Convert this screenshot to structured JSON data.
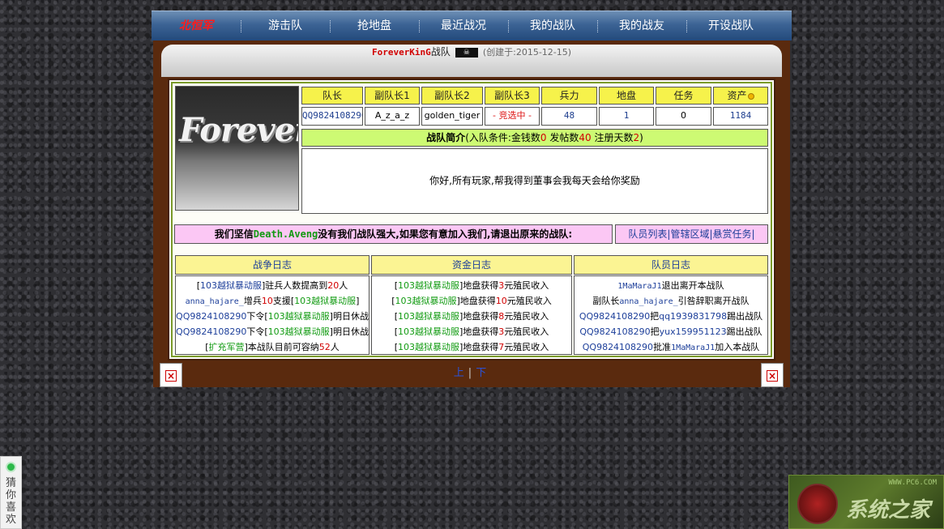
{
  "nav": {
    "items": [
      "北恒军",
      "游击队",
      "抢地盘",
      "最近战况",
      "我的战队",
      "我的战友",
      "开设战队"
    ]
  },
  "header": {
    "team_name": "ForeverKinG",
    "team_suffix": "战队",
    "flag_icon": "pirate-flag-icon",
    "created": "(创建于:2015-12-15)"
  },
  "logo": {
    "text": "Forever"
  },
  "stats": {
    "headers": [
      "队长",
      "副队长1",
      "副队长2",
      "副队长3",
      "兵力",
      "地盘",
      "任务",
      "资产"
    ],
    "values": [
      "QQ9824108290",
      "A_z_a_z",
      "golden_tiger",
      "- 竞选中 -",
      "48",
      "1",
      "0",
      "1184"
    ],
    "asset_icon": "coin-icon"
  },
  "intro": {
    "title": "战队简介",
    "cond_open": "(入队条件:金钱数",
    "money": "0",
    "posts_label": " 发帖数",
    "posts": "40",
    "days_label": " 注册天数",
    "days": "2",
    "cond_close": ")",
    "body": "你好,所有玩家,帮我得到董事会我每天会给你奖励"
  },
  "slogan": {
    "before": "我们坚信",
    "name": "Death.Aveng",
    "after": "没有我们战队强大,如果您有意加入我们,请退出原来的战队:"
  },
  "links": [
    "队员列表",
    "管辖区域",
    "悬赏任务"
  ],
  "logs": {
    "war": {
      "title": "战争日志",
      "lines": [
        [
          "[",
          "103越狱暴动服",
          "]驻兵人数提高到",
          "20",
          "人"
        ],
        [
          "anna_hajare_",
          "增兵",
          "10",
          "支援[",
          "103越狱暴动服",
          "]"
        ],
        [
          "QQ9824108290",
          "下令[",
          "103越狱暴动服",
          "]明日休战"
        ],
        [
          "QQ9824108290",
          "下令[",
          "103越狱暴动服",
          "]明日休战"
        ],
        [
          "[",
          "扩充军营",
          "]本战队目前可容纳",
          "52",
          "人"
        ]
      ]
    },
    "fund": {
      "title": "资金日志",
      "lines": [
        [
          "[",
          "103越狱暴动服",
          "]地盘获得",
          "3",
          "元殖民收入"
        ],
        [
          "[",
          "103越狱暴动服",
          "]地盘获得",
          "10",
          "元殖民收入"
        ],
        [
          "[",
          "103越狱暴动服",
          "]地盘获得",
          "8",
          "元殖民收入"
        ],
        [
          "[",
          "103越狱暴动服",
          "]地盘获得",
          "3",
          "元殖民收入"
        ],
        [
          "[",
          "103越狱暴动服",
          "]地盘获得",
          "7",
          "元殖民收入"
        ]
      ]
    },
    "member": {
      "title": "队员日志",
      "lines": [
        [
          "1MaMaraJ1",
          "退出离开本战队"
        ],
        [
          "副队长",
          "anna_hajare_",
          "引咎辞职离开战队"
        ],
        [
          "QQ9824108290",
          "把",
          "qq1939831798",
          "踢出战队"
        ],
        [
          "QQ9824108290",
          "把",
          "yux159951123",
          "踢出战队"
        ],
        [
          "QQ9824108290",
          "批准",
          "1MaMaraJ1",
          "加入本战队"
        ]
      ]
    }
  },
  "pager": {
    "prev": "上",
    "sep": "|",
    "next": "下"
  },
  "footer_icons": {
    "close_left": "close-icon",
    "close_right": "close-icon"
  },
  "side": {
    "guess_chars": [
      "猜",
      "你",
      "喜",
      "欢"
    ],
    "watermark_site": "WWW.PC6.COM",
    "watermark_text": "系统之家"
  },
  "colors": {
    "accent_yellow": "#f6f24b",
    "intro_green": "#cdfa73",
    "slogan_pink": "#fbc7f4",
    "frame_brown": "#5a2a0e",
    "nav_blue": "#3c6394"
  }
}
